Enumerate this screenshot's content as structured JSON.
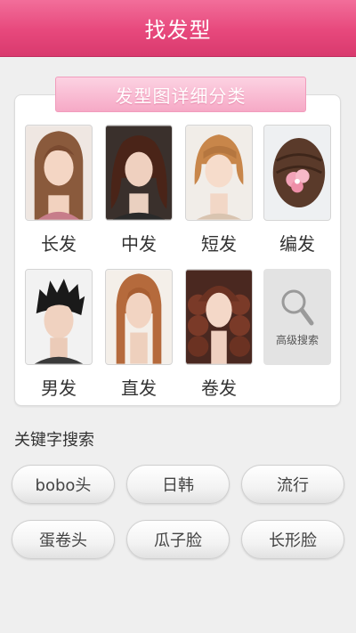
{
  "header": {
    "title": "找发型"
  },
  "panel": {
    "ribbon_title": "发型图详细分类"
  },
  "categories": [
    {
      "label": "长发"
    },
    {
      "label": "中发"
    },
    {
      "label": "短发"
    },
    {
      "label": "编发"
    },
    {
      "label": "男发"
    },
    {
      "label": "直发"
    },
    {
      "label": "卷发"
    }
  ],
  "advanced_search": {
    "label": "高级搜索",
    "icon": "magnifier-icon"
  },
  "keywords": {
    "title": "关键字搜索",
    "items": [
      {
        "label": "bobo头"
      },
      {
        "label": "日韩"
      },
      {
        "label": "流行"
      },
      {
        "label": "蛋卷头"
      },
      {
        "label": "瓜子脸"
      },
      {
        "label": "长形脸"
      }
    ]
  },
  "colors": {
    "header": "#e7487c",
    "ribbon": "#f6a9c6",
    "background": "#efefef"
  }
}
